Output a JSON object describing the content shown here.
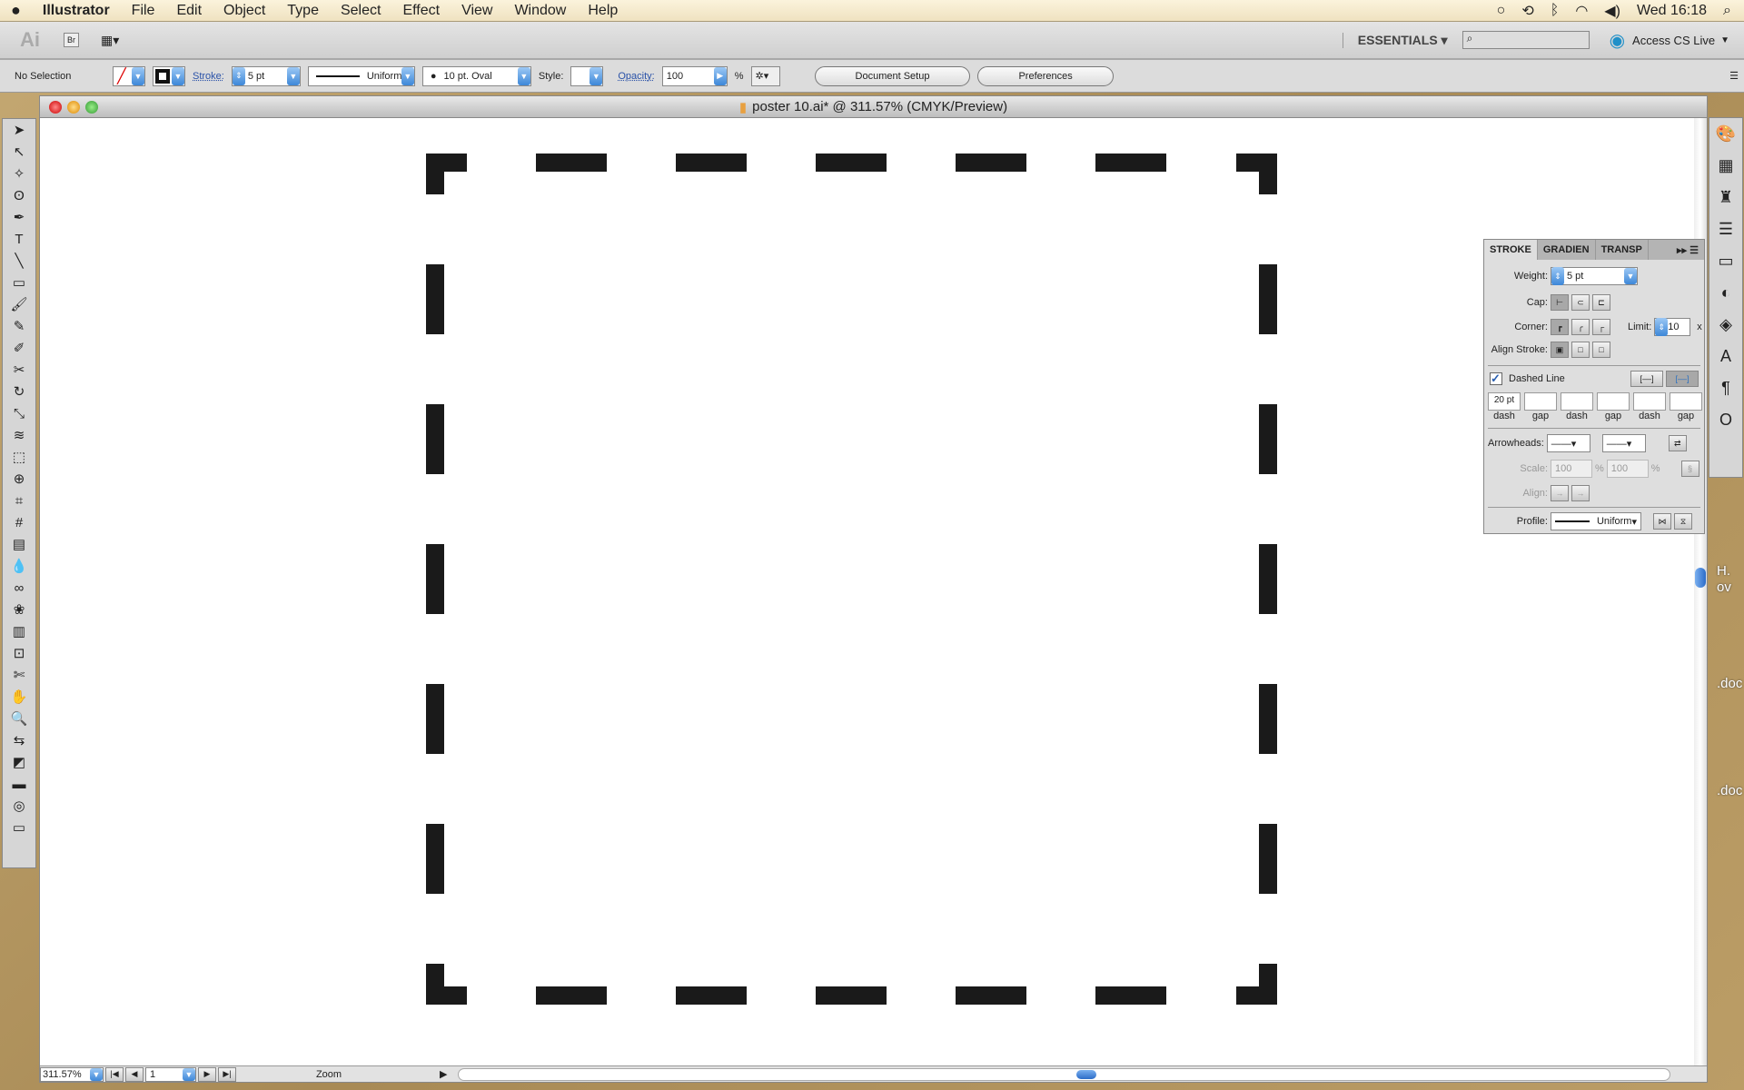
{
  "menubar": {
    "apple": "",
    "app": "Illustrator",
    "items": [
      "File",
      "Edit",
      "Object",
      "Type",
      "Select",
      "Effect",
      "View",
      "Window",
      "Help"
    ],
    "clock": "Wed 16:18"
  },
  "appbar": {
    "logo": "Ai",
    "bridge": "Br",
    "workspace": "ESSENTIALS ▾",
    "search_placeholder": "",
    "cs_live": "Access CS Live"
  },
  "control": {
    "selection": "No Selection",
    "stroke_label": "Stroke:",
    "stroke_weight": "5 pt",
    "profile": "Uniform",
    "brush": "10 pt. Oval",
    "style_label": "Style:",
    "opacity_label": "Opacity:",
    "opacity": "100",
    "percent": "%",
    "document_setup": "Document Setup",
    "preferences": "Preferences"
  },
  "document": {
    "title": "poster 10.ai* @ 311.57% (CMYK/Preview)",
    "zoom": "311.57%",
    "artboard": "1",
    "status": "Zoom"
  },
  "artwork": {
    "stroke_color": "#1a1a1a",
    "style": "dashed rectangle"
  },
  "stroke_panel": {
    "tabs": [
      "STROKE",
      "GRADIEN",
      "TRANSP"
    ],
    "weight_label": "Weight:",
    "weight": "5 pt",
    "cap_label": "Cap:",
    "corner_label": "Corner:",
    "limit_label": "Limit:",
    "limit": "10",
    "limit_unit": "x",
    "align_label": "Align Stroke:",
    "dashed_label": "Dashed Line",
    "dashed_checked": true,
    "dash_fields": [
      {
        "value": "20 pt",
        "label": "dash"
      },
      {
        "value": "",
        "label": "gap"
      },
      {
        "value": "",
        "label": "dash"
      },
      {
        "value": "",
        "label": "gap"
      },
      {
        "value": "",
        "label": "dash"
      },
      {
        "value": "",
        "label": "gap"
      }
    ],
    "arrowheads_label": "Arrowheads:",
    "scale_label": "Scale:",
    "scale1": "100",
    "scale2": "100",
    "pct": "%",
    "align2_label": "Align:",
    "profile_label": "Profile:",
    "profile": "Uniform"
  },
  "desktop": {
    "files": [
      "H.",
      "ov",
      ".doc",
      ".doc"
    ]
  },
  "colors": {
    "accent": "#3d87d8"
  }
}
